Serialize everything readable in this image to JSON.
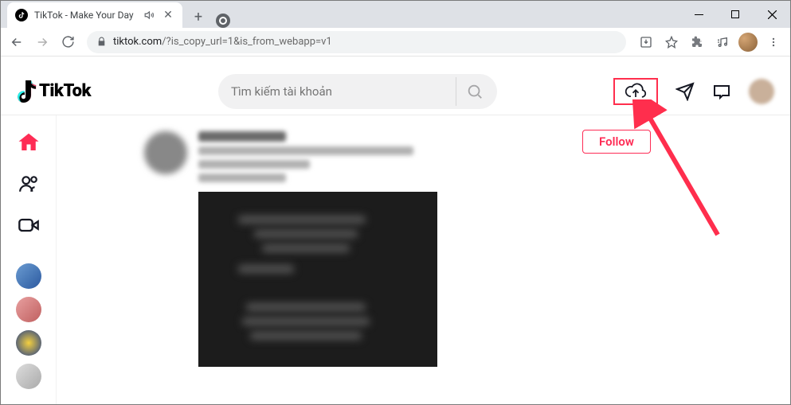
{
  "browser": {
    "tab_title": "TikTok - Make Your Day",
    "url_domain": "tiktok.com",
    "url_path": "/?is_copy_url=1&is_from_webapp=v1"
  },
  "header": {
    "logo_text": "TikTok",
    "search_placeholder": "Tìm kiếm tài khoản"
  },
  "feed": {
    "follow_label": "Follow"
  },
  "icons": {
    "home": "home-icon",
    "following": "following-icon",
    "live": "live-icon",
    "upload": "upload-cloud-icon",
    "send": "send-icon",
    "inbox": "inbox-icon",
    "search": "search-icon"
  }
}
